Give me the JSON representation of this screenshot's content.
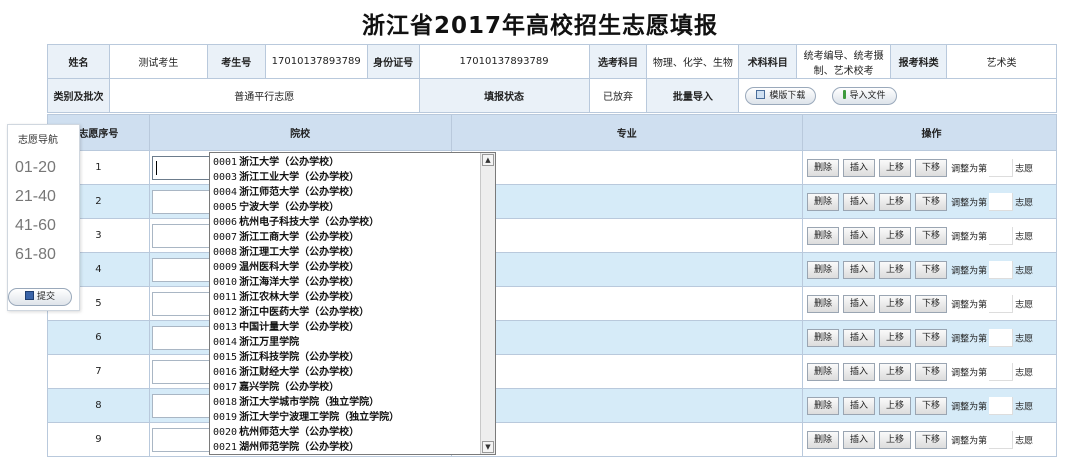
{
  "page": {
    "title": "浙江省2017年高校招生志愿填报"
  },
  "info": {
    "name_label": "姓名",
    "name_value": "测试考生",
    "exam_no_label": "考生号",
    "exam_no_value": "17010137893789",
    "id_label": "身份证号",
    "id_value": "17010137893789",
    "subjects_label": "选考科目",
    "subjects_value": "物理、化学、生物",
    "tech_label": "术科科目",
    "tech_value": "统考编导、统考摄制、艺术校考",
    "category_label": "报考科类",
    "category_value": "艺术类",
    "batch_label": "类别及批次",
    "batch_value": "普通平行志愿",
    "status_label": "填报状态",
    "status_value": "已放弃",
    "bulk_label": "批量导入",
    "template_btn": "模版下载",
    "import_btn": "导入文件"
  },
  "table": {
    "headers": {
      "seq": "志愿序号",
      "school": "院校",
      "major": "专业",
      "ops": "操作"
    },
    "rows": [
      "1",
      "2",
      "3",
      "4",
      "5",
      "6",
      "7",
      "8",
      "9"
    ],
    "ops": {
      "delete": "删除",
      "insert": "插入",
      "up": "上移",
      "down": "下移",
      "adjust_prefix": "调整为第",
      "adjust_suffix": "志愿"
    }
  },
  "nav": {
    "title": "志愿导航",
    "items": [
      "01-20",
      "21-40",
      "41-60",
      "61-80"
    ],
    "submit": "提交"
  },
  "dropdown": {
    "items": [
      {
        "code": "0001",
        "name": "浙江大学（公办学校）"
      },
      {
        "code": "0003",
        "name": "浙江工业大学（公办学校）"
      },
      {
        "code": "0004",
        "name": "浙江师范大学（公办学校）"
      },
      {
        "code": "0005",
        "name": "宁波大学（公办学校）"
      },
      {
        "code": "0006",
        "name": "杭州电子科技大学（公办学校）"
      },
      {
        "code": "0007",
        "name": "浙江工商大学（公办学校）"
      },
      {
        "code": "0008",
        "name": "浙江理工大学（公办学校）"
      },
      {
        "code": "0009",
        "name": "温州医科大学（公办学校）"
      },
      {
        "code": "0010",
        "name": "浙江海洋大学（公办学校）"
      },
      {
        "code": "0011",
        "name": "浙江农林大学（公办学校）"
      },
      {
        "code": "0012",
        "name": "浙江中医药大学（公办学校）"
      },
      {
        "code": "0013",
        "name": "中国计量大学（公办学校）"
      },
      {
        "code": "0014",
        "name": "浙江万里学院"
      },
      {
        "code": "0015",
        "name": "浙江科技学院（公办学校）"
      },
      {
        "code": "0016",
        "name": "浙江财经大学（公办学校）"
      },
      {
        "code": "0017",
        "name": "嘉兴学院（公办学校）"
      },
      {
        "code": "0018",
        "name": "浙江大学城市学院（独立学院）"
      },
      {
        "code": "0019",
        "name": "浙江大学宁波理工学院（独立学院）"
      },
      {
        "code": "0020",
        "name": "杭州师范大学（公办学校）"
      },
      {
        "code": "0021",
        "name": "湖州师范学院（公办学校）"
      }
    ]
  },
  "colors": {
    "header_bg": "#cfdff0",
    "alt_row": "#d6ebf8",
    "label_bg": "#eaf1f8",
    "border": "#b9c9dc"
  },
  "icons": [
    "template-download-icon",
    "import-file-icon",
    "save-icon",
    "scroll-up-icon",
    "scroll-down-icon"
  ]
}
